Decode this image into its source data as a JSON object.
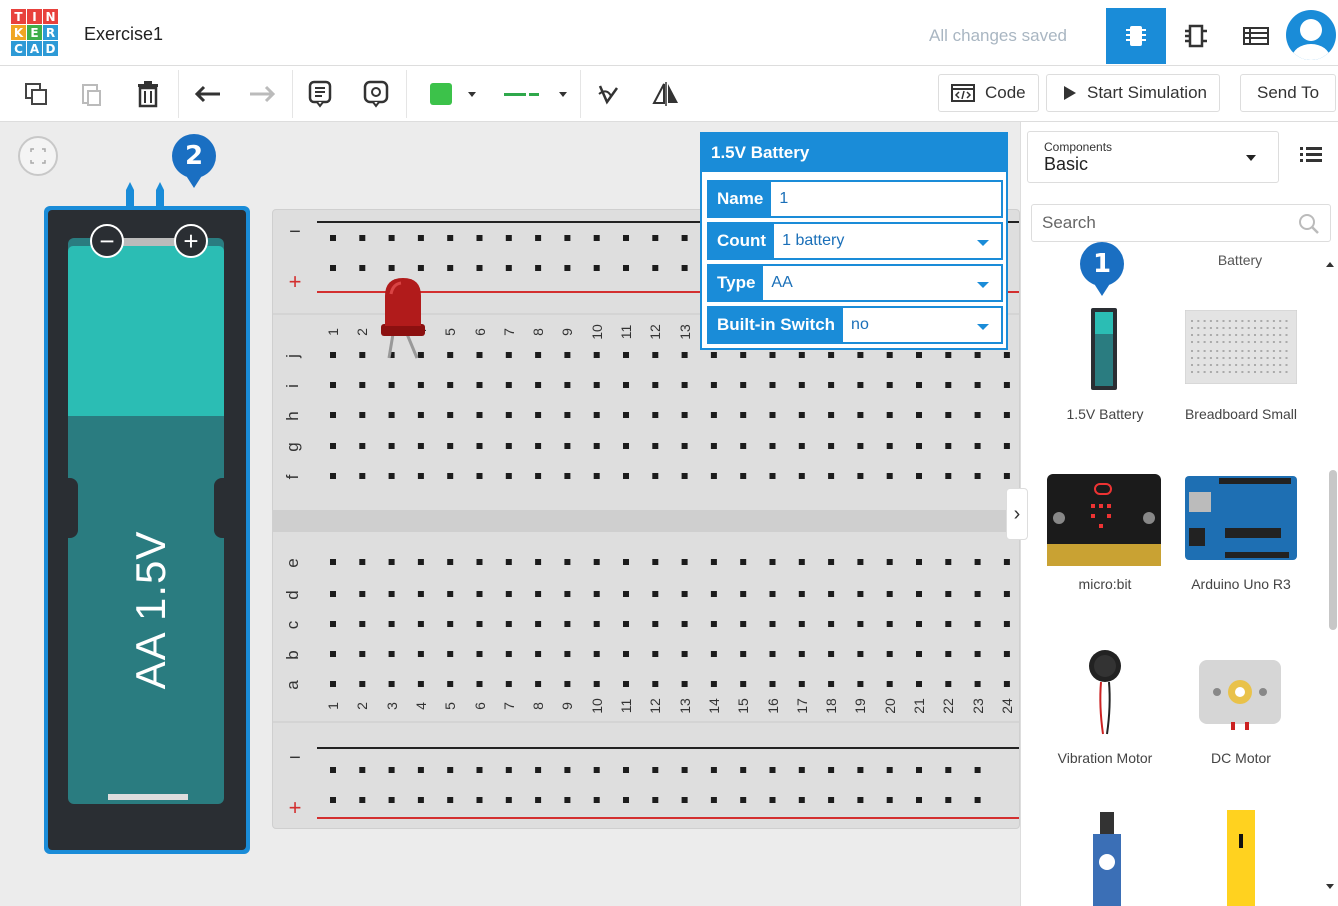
{
  "app": {
    "logo_letters": [
      "T",
      "I",
      "N",
      "K",
      "E",
      "R",
      "C",
      "A",
      "D"
    ],
    "project_title": "Exercise1",
    "save_status": "All changes saved"
  },
  "toolbar": {
    "code_label": "Code",
    "start_simulation_label": "Start Simulation",
    "send_to_label": "Send To",
    "color_swatch": "#3cc24a",
    "wire_color": "#2fa84b"
  },
  "badges": {
    "badge1": "1",
    "badge2": "2"
  },
  "battery": {
    "label": "AA 1.5V"
  },
  "breadboard": {
    "top_numbers": [
      "1",
      "2",
      "3",
      "4",
      "5",
      "6",
      "7",
      "8",
      "9",
      "10",
      "11",
      "12",
      "13"
    ],
    "bottom_numbers": [
      "1",
      "2",
      "3",
      "4",
      "5",
      "6",
      "7",
      "8",
      "9",
      "10",
      "11",
      "12",
      "13",
      "14",
      "15",
      "16",
      "17",
      "18",
      "19",
      "20",
      "21",
      "22",
      "23",
      "24"
    ],
    "rows_top": [
      "j",
      "i",
      "h",
      "g",
      "f"
    ],
    "rows_bottom": [
      "e",
      "d",
      "c",
      "b",
      "a"
    ],
    "rail_minus": "−",
    "rail_plus": "+"
  },
  "properties": {
    "title": "1.5V Battery",
    "name_label": "Name",
    "name_value": "1",
    "count_label": "Count",
    "count_value": "1 battery",
    "type_label": "Type",
    "type_value": "AA",
    "switch_label": "Built-in Switch",
    "switch_value": "no"
  },
  "panel": {
    "components_small": "Components",
    "components_selected": "Basic",
    "search_placeholder": "Search",
    "category_heading": "Battery",
    "items": [
      {
        "label": "1.5V Battery"
      },
      {
        "label": "Breadboard Small"
      },
      {
        "label": "micro:bit"
      },
      {
        "label": "Arduino Uno R3"
      },
      {
        "label": "Vibration Motor"
      },
      {
        "label": "DC Motor"
      }
    ]
  },
  "colors": {
    "accent": "#1a8cd8",
    "battery_teal": "#2bbdb4",
    "battery_dark_teal": "#2a7c80",
    "led_red": "#b11b1b",
    "rail_red": "#d32f2f"
  }
}
